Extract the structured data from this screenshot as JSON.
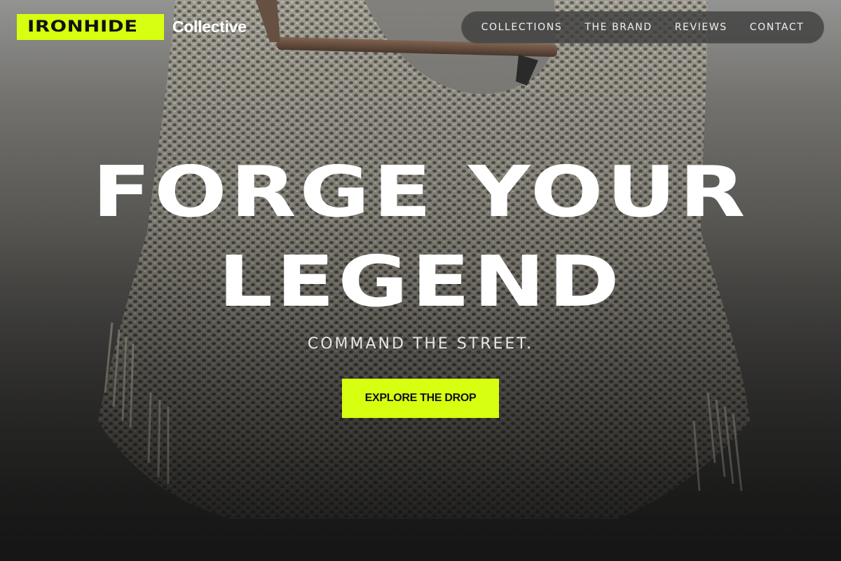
{
  "brand": {
    "name": "IRONHIDE",
    "suffix": "Collective",
    "accent_color": "#d7ff10"
  },
  "nav": {
    "items": [
      {
        "label": "COLLECTIONS"
      },
      {
        "label": "THE BRAND"
      },
      {
        "label": "REVIEWS"
      },
      {
        "label": "CONTACT"
      }
    ]
  },
  "hero": {
    "headline_line1": "FORGE YOUR",
    "headline_line2": "LEGEND",
    "subheadline": "COMMAND THE STREET.",
    "cta_label": "EXPLORE THE DROP",
    "background_image": "knit-garment-on-hanger"
  }
}
